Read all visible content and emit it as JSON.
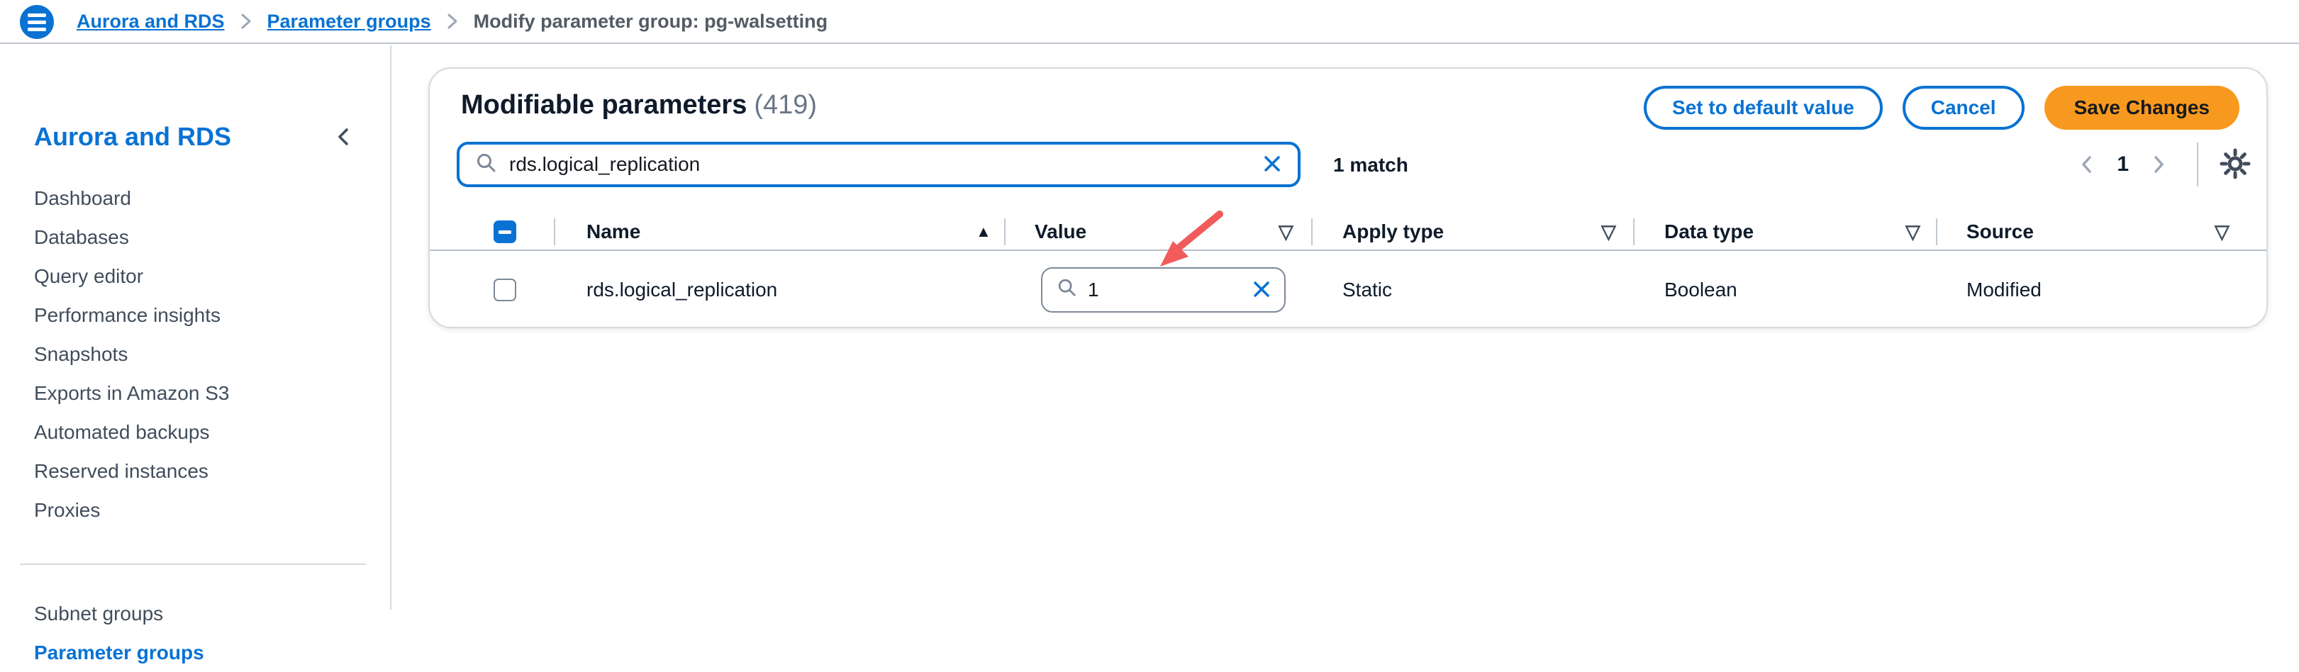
{
  "topbar": {
    "breadcrumb": {
      "link1": "Aurora and RDS",
      "link2": "Parameter groups",
      "current": "Modify parameter group: pg-walsetting"
    }
  },
  "sidebar": {
    "title": "Aurora and RDS",
    "items": [
      "Dashboard",
      "Databases",
      "Query editor",
      "Performance insights",
      "Snapshots",
      "Exports in Amazon S3",
      "Automated backups",
      "Reserved instances",
      "Proxies"
    ],
    "secondary_items": [
      "Subnet groups",
      "Parameter groups"
    ],
    "active_item": "Parameter groups"
  },
  "main": {
    "title": "Modifiable parameters",
    "count": "(419)",
    "actions": {
      "set_default": "Set to default value",
      "cancel": "Cancel",
      "save": "Save Changes"
    },
    "filter": {
      "value": "rds.logical_replication",
      "match_count": "1 match"
    },
    "pagination": {
      "current_page": "1"
    },
    "table": {
      "headers": {
        "name": "Name",
        "value": "Value",
        "apply_type": "Apply type",
        "data_type": "Data type",
        "source": "Source"
      },
      "row": {
        "name": "rds.logical_replication",
        "value": "1",
        "apply_type": "Static",
        "data_type": "Boolean",
        "source": "Modified"
      }
    }
  },
  "icons": {
    "sort_ascending": "▲",
    "filter": "▽"
  },
  "colors": {
    "accent_blue": "#0972d3",
    "save_orange": "#f8991f",
    "annotation_red": "#f15b5b"
  }
}
